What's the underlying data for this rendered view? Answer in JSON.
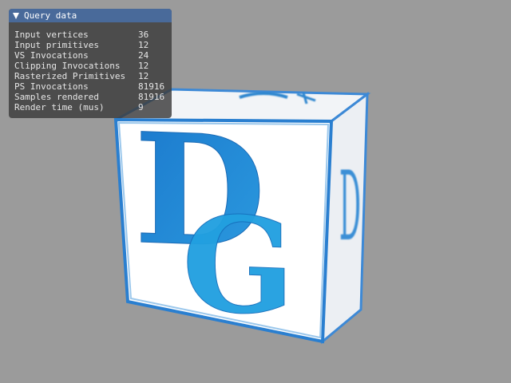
{
  "scene": {
    "logo_letter_1": "D",
    "logo_letter_2": "G",
    "colors": {
      "background": "#9b9b9b",
      "cube_face": "#ffffff",
      "logo_blue": "#1f86d2",
      "edge_blue": "#2a7fd0"
    }
  },
  "query_panel": {
    "title": "Query data",
    "collapse_icon": "triangle-down-icon",
    "stats": [
      {
        "label": "Input vertices",
        "value": "36"
      },
      {
        "label": "Input primitives",
        "value": "12"
      },
      {
        "label": "VS Invocations",
        "value": "24"
      },
      {
        "label": "Clipping Invocations",
        "value": "12"
      },
      {
        "label": "Rasterized Primitives",
        "value": "12"
      },
      {
        "label": "PS Invocations",
        "value": "81916"
      },
      {
        "label": "Samples rendered",
        "value": "81916"
      },
      {
        "label": "Render time (mus)",
        "value": "9"
      }
    ]
  }
}
